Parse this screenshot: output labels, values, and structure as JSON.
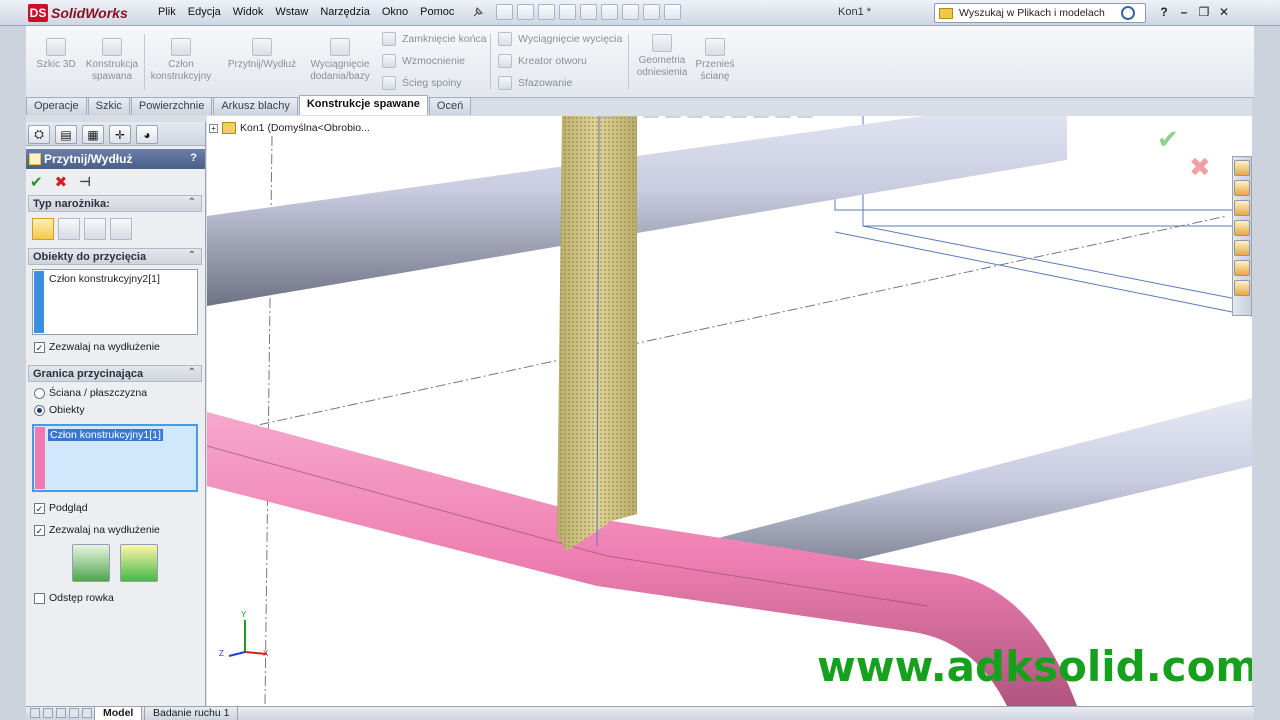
{
  "app": {
    "brand": "SolidWorks",
    "logo_mark": "DS",
    "doc_title": "Kon1 *"
  },
  "menu": [
    "Plik",
    "Edycja",
    "Widok",
    "Wstaw",
    "Narzędzia",
    "Okno",
    "Pomoc"
  ],
  "search": {
    "placeholder": "Wyszukaj w Plikach i modelach"
  },
  "window_controls": {
    "help": "?",
    "minimize": "–",
    "restore": "❐",
    "close": "✕"
  },
  "ribbon": {
    "big": [
      {
        "label": "Szkic 3D"
      },
      {
        "label": "Konstrukcja spawana"
      },
      {
        "label": "Człon konstrukcyjny"
      },
      {
        "label": "Przytnij/Wydłuż"
      },
      {
        "label": "Wyciągnięcie dodania/bazy"
      },
      {
        "label": "Geometria odniesienia"
      },
      {
        "label": "Przenieś ścianę"
      }
    ],
    "small_col1": [
      "Zamknięcie końca",
      "Wzmocnienie",
      "Ścieg spoiny"
    ],
    "small_col2": [
      "Wyciągnięcie wycięcia",
      "Kreator otworu",
      "Sfazowanie"
    ]
  },
  "tabs": [
    "Operacje",
    "Szkic",
    "Powierzchnie",
    "Arkusz blachy",
    "Konstrukcje spawane",
    "Oceń"
  ],
  "active_tab": "Konstrukcje spawane",
  "property_manager": {
    "title": "Przytnij/Wydłuż",
    "help": "?",
    "ok": "✔",
    "cancel": "✖",
    "pin": "⊣",
    "corner_group": {
      "title": "Typ narożnika:"
    },
    "trim_objects": {
      "title": "Obiekty do przycięcia",
      "items": [
        "Człon konstrukcyjny2[1]"
      ],
      "color": "#3d8ee0",
      "allow_extend": "Zezwalaj na wydłużenie",
      "allow_extend_checked": true
    },
    "trim_boundary": {
      "title": "Granica przycinająca",
      "option_face": "Ściana / płaszczyzna",
      "option_bodies": "Obiekty",
      "selected_option": "Obiekty",
      "items": [
        "Człon konstrukcyjny1[1]"
      ],
      "color": "#f07ab0",
      "preview": "Podgląd",
      "preview_checked": true,
      "allow_extend": "Zezwalaj na wydłużenie",
      "allow_extend_checked": true,
      "weld_gap": "Odstęp rowka",
      "weld_gap_checked": false
    },
    "collapse_icon": "⌃"
  },
  "viewport": {
    "tree_root": "Kon1 (Domyślna<Obrobio...",
    "confirm_ok": "✔",
    "confirm_cancel": "✖",
    "triad": {
      "x": "X",
      "y": "Y",
      "z": "Z"
    }
  },
  "watermark": "www.adksolid.com",
  "bottom_tabs": [
    "Model",
    "Badanie ruchu 1"
  ],
  "active_bottom_tab": "Model"
}
